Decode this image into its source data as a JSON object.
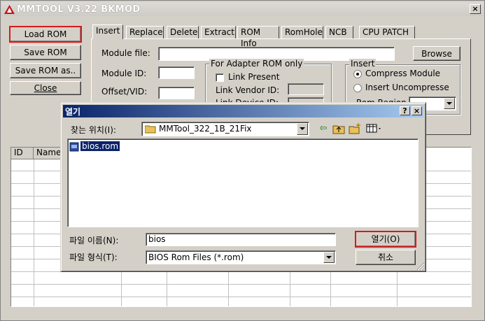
{
  "app": {
    "title": "MMTOOL V3.22 BKMOD",
    "close_label": "×"
  },
  "left_buttons": {
    "load_rom": "Load ROM",
    "save_rom": "Save ROM",
    "save_rom_as": "Save ROM as..",
    "close": "Close"
  },
  "tabs": [
    "Insert",
    "Replace",
    "Delete",
    "Extract",
    "ROM Info",
    "RomHole",
    "NCB",
    "CPU PATCH"
  ],
  "insert_panel": {
    "module_file_label": "Module file:",
    "browse_label": "Browse",
    "module_id_label": "Module ID:",
    "offset_vid_label": "Offset/VID:",
    "adapter_group_title": "For Adapter ROM only",
    "link_present_label": "Link Present",
    "link_vendor_label": "Link Vendor ID:",
    "link_device_label": "Link Device ID:",
    "insert_group_title": "Insert",
    "compress_label": "Compress Module",
    "uncompress_label": "Insert Uncompresse",
    "rom_region_label": "Rom Region"
  },
  "module_grid": {
    "columns": [
      "ID",
      "Name"
    ]
  },
  "open_dialog": {
    "title": "열기",
    "help_label": "?",
    "close_label": "×",
    "look_in_label": "찾는 위치(I):",
    "look_in_value": "MMTool_322_1B_21Fix",
    "files": [
      "bios.rom"
    ],
    "filename_label": "파일 이름(N):",
    "filename_value": "bios",
    "filetype_label": "파일 형식(T):",
    "filetype_value": "BIOS Rom Files (*.rom)",
    "open_button": "열기(O)",
    "cancel_button": "취소"
  }
}
